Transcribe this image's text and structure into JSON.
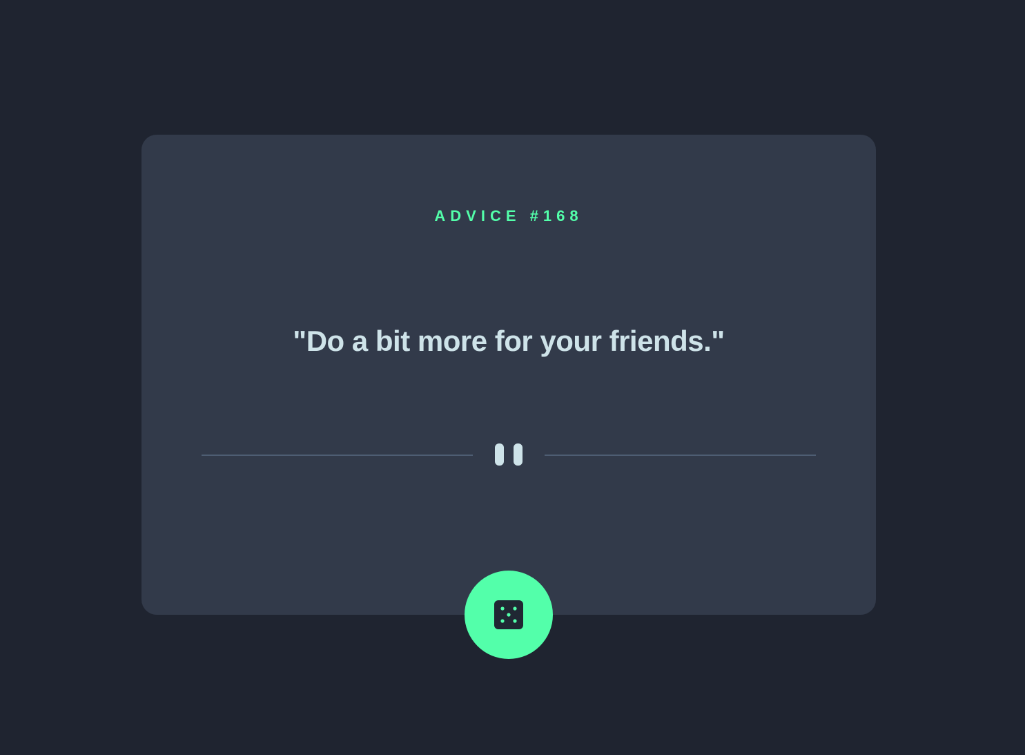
{
  "advice": {
    "label": "ADVICE #168",
    "quote": "\"Do a bit more for your friends.\""
  },
  "icons": {
    "divider": "pause-icon",
    "button": "dice-icon"
  },
  "colors": {
    "background": "#1f2430",
    "card": "#323a4a",
    "accent": "#53ffaa",
    "text": "#cee3e9",
    "divider_line": "#4e5d73"
  }
}
